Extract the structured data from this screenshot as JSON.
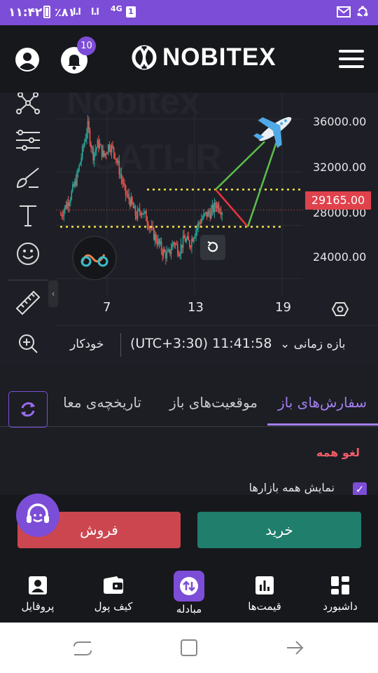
{
  "status_bar": {
    "time": "۱۱:۴۲",
    "battery_pct": "٪۸۱",
    "signal_1": "l.l",
    "signal_2": "l.l",
    "network": "4G",
    "sim_slot": "1",
    "right_icons": [
      "mail-icon",
      "sync-icon"
    ]
  },
  "header": {
    "brand": "NOBITEX",
    "notification_count": "10",
    "icons": [
      "account-icon",
      "bell-icon",
      "menu-icon"
    ]
  },
  "chart": {
    "price_labels": [
      "36000.00",
      "32000.00",
      "28000.00",
      "24000.00"
    ],
    "current_price": "29165.00",
    "x_labels": [
      "7",
      "13",
      "19"
    ],
    "watermark": "Nobitex CATI-IR",
    "tools": [
      "network-icon",
      "indicators-icon",
      "brush-icon",
      "text-tool-icon",
      "emoji-icon",
      "ruler-icon",
      "zoom-in-icon"
    ],
    "colors": {
      "up": "#26a69a",
      "down": "#ef5350",
      "current_price": "#e0424c"
    },
    "chart_data": {
      "type": "candlestick",
      "x_ticks": [
        "7",
        "13",
        "19"
      ],
      "y_ticks": [
        24000,
        28000,
        32000,
        36000
      ],
      "ylim": [
        22700,
        38000
      ],
      "last_price": 29165.0,
      "support_level": 27900,
      "resistance_level": 30700,
      "close_path": [
        28800,
        29500,
        30400,
        31600,
        33500,
        35500,
        33300,
        34200,
        33200,
        34100,
        33500,
        32000,
        30400,
        29800,
        28700,
        29200,
        28500,
        27500,
        26800,
        26000,
        25700,
        26800,
        26100,
        27000,
        26600,
        27600,
        28400,
        28800,
        29000,
        29600,
        29165
      ]
    }
  },
  "chart_bar": {
    "timeframe_label": "بازه زمانی",
    "timezone_clock": "(UTC+3:30) 11:41:58",
    "auto_label": "خودکار"
  },
  "tabs": {
    "open_orders": "سفارش‌های باز",
    "open_positions": "موقعیت‌های باز",
    "trade_history": "تاریخچه‌ی معا"
  },
  "orders": {
    "cancel_all": "لغو همه",
    "show_all_markets": "نمایش همه بازارها"
  },
  "actions": {
    "sell": "فروش",
    "buy": "خرید"
  },
  "bottom_nav": {
    "profile": "پروفایل",
    "wallet": "کیف پول",
    "exchange": "مبادله",
    "prices": "قیمت‌ها",
    "dashboard": "داشبورد"
  }
}
